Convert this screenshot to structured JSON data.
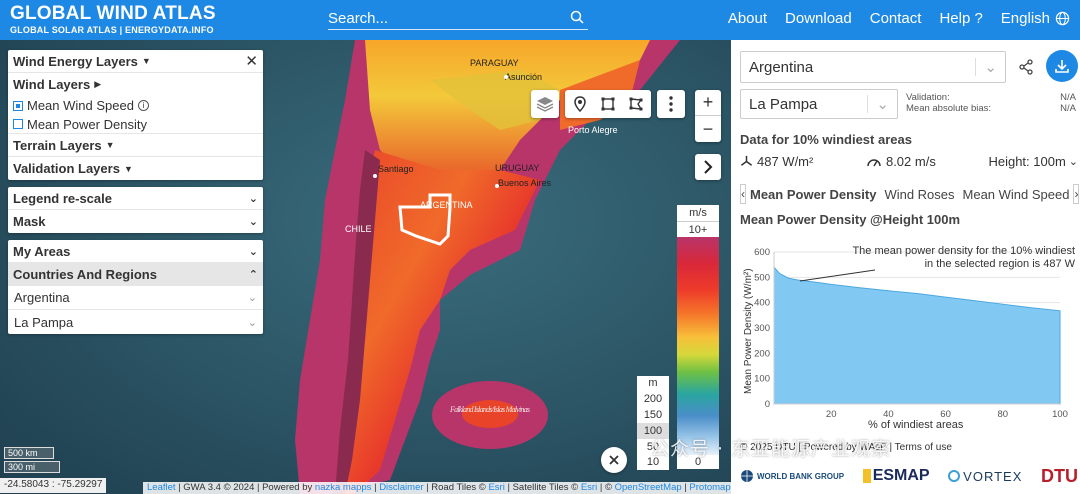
{
  "brand": {
    "title": "GLOBAL WIND ATLAS",
    "subtitle": "GLOBAL SOLAR ATLAS | ENERGYDATA.INFO"
  },
  "search": {
    "placeholder": "Search..."
  },
  "nav": {
    "about": "About",
    "download": "Download",
    "contact": "Contact",
    "help": "Help ?",
    "language": "English"
  },
  "layers": {
    "wind_energy": "Wind Energy Layers",
    "wind": "Wind Layers",
    "mean_wind_speed": "Mean Wind Speed",
    "mean_power_density": "Mean Power Density",
    "terrain": "Terrain Layers",
    "validation": "Validation Layers",
    "legend_rescale": "Legend re-scale",
    "mask": "Mask",
    "my_areas": "My Areas",
    "countries_regions": "Countries And Regions",
    "country": "Argentina",
    "region": "La Pampa"
  },
  "map_labels": {
    "paraguay": "PARAGUAY",
    "asuncion": "Asunción",
    "porto_alegre": "Porto Alegre",
    "uruguay": "URUGUAY",
    "santiago": "Santiago",
    "buenos_aires": "Buenos Aires",
    "argentina": "ARGENTINA",
    "chile": "CHILE",
    "falkland": "Falkland Islands/Islas Malvinas"
  },
  "legend_ms": {
    "unit": "m/s",
    "top": "10+",
    "bottom": "0"
  },
  "legend_m": {
    "unit": "m",
    "values": [
      "200",
      "150",
      "100",
      "50",
      "10"
    ]
  },
  "scale": {
    "km": "500 km",
    "mi": "300 mi"
  },
  "coords": "-24.58043 : -75.29297",
  "attribution": {
    "leaflet": "Leaflet",
    "gwa": "| GWA 3.4 © 2024 | Powered by",
    "nazka": "nazka mapps",
    "sep1": "|",
    "disclaimer": "Disclaimer",
    "road": "| Road Tiles ©",
    "esri1": "Esri",
    "sat": "| Satellite Tiles ©",
    "esri2": "Esri",
    "sep2": "| ©",
    "osm": "OpenStreetMap",
    "sep3": "|",
    "protomaps": "Protomaps"
  },
  "right": {
    "country": "Argentina",
    "region": "La Pampa",
    "validation_label": "Validation:",
    "validation_value": "N/A",
    "bias_label": "Mean absolute bias:",
    "bias_value": "N/A",
    "data_title": "Data for 10% windiest areas",
    "power_density": "487 W/m²",
    "wind_speed": "8.02 m/s",
    "height": "Height: 100m",
    "tab1": "Mean Power Density",
    "tab2": "Wind Roses",
    "tab3": "Mean Wind Speed",
    "chart_title": "Mean Power Density @Height 100m",
    "footer": "© 2025  DTU | Powered by WAsP | Terms of use",
    "logo1": "WORLD BANK GROUP",
    "logo2": "ESMAP",
    "logo3": "VORTEX",
    "logo4": "DTU"
  },
  "watermark": "公众号 · 东亚能源产业观察",
  "colors": {
    "brand": "#1e88e5",
    "chart_fill": "#81c9f2",
    "chart_line": "#4aa8e0"
  },
  "chart_data": {
    "type": "area",
    "title": "Mean Power Density @Height 100m",
    "xlabel": "% of windiest areas",
    "ylabel": "Mean Power Density (W/m²)",
    "x": [
      0,
      2,
      5,
      8,
      10,
      15,
      20,
      30,
      40,
      50,
      60,
      70,
      80,
      90,
      100
    ],
    "values": [
      540,
      515,
      497,
      490,
      487,
      480,
      472,
      459,
      447,
      436,
      422,
      408,
      394,
      380,
      368
    ],
    "xlim": [
      0,
      100
    ],
    "ylim": [
      0,
      600
    ],
    "xticks": [
      "20",
      "40",
      "60",
      "80",
      "100"
    ],
    "yticks": [
      "0",
      "200",
      "400",
      "600"
    ],
    "yticks_minor": [
      "100",
      "300",
      "500"
    ],
    "annotation": "The mean power density for the 10% windiest in the selected region is 487 W",
    "annotation_line1": "The mean power density for the 10% windiest",
    "annotation_line2": "in the selected region is 487 W"
  }
}
